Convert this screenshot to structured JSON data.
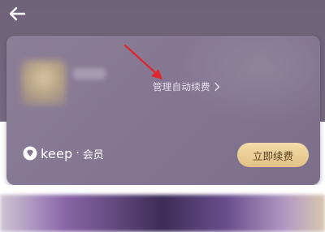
{
  "header": {
    "back_icon": "arrow-left-icon"
  },
  "membership_card": {
    "manage_auto_renew_label": "管理自动续费",
    "manage_chevron_icon": "chevron-right-icon",
    "brand": {
      "logo_icon": "keep-diamond-icon",
      "name": "keep",
      "separator": "·",
      "member_label": "会员"
    },
    "renew_button_label": "立即续费",
    "colors": {
      "card_background": "#857792",
      "renew_button": "#e9cc95",
      "renew_button_text": "#5a3f1e",
      "annotation_arrow": "#e0262c"
    }
  },
  "annotation": {
    "icon": "red-pointer-arrow-icon"
  }
}
